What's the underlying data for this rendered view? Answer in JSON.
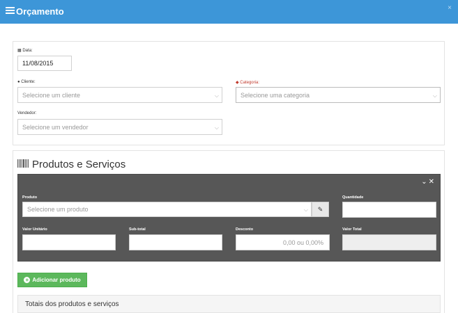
{
  "window": {
    "title": "Orçamento",
    "close": "×"
  },
  "form": {
    "date_label": "Data:",
    "date_value": "11/08/2015",
    "client_label": "Cliente:",
    "client_placeholder": "Selecione um cliente",
    "category_label": "Categoria:",
    "category_placeholder": "Selecione uma categoria",
    "seller_label": "Vendedor:",
    "seller_placeholder": "Selecione um vendedor"
  },
  "products": {
    "title": "Produtos e Serviços",
    "product_label": "Produto",
    "product_placeholder": "Selecione um produto",
    "quantity_label": "Quantidade",
    "unit_value_label": "Valor Unitário",
    "subtotal_label": "Sub-total",
    "discount_label": "Desconto",
    "discount_placeholder": "0,00 ou 0,00%",
    "total_label": "Valor Total",
    "add_button": "Adicionar produto",
    "totals_title": "Totais dos produtos e serviços"
  }
}
